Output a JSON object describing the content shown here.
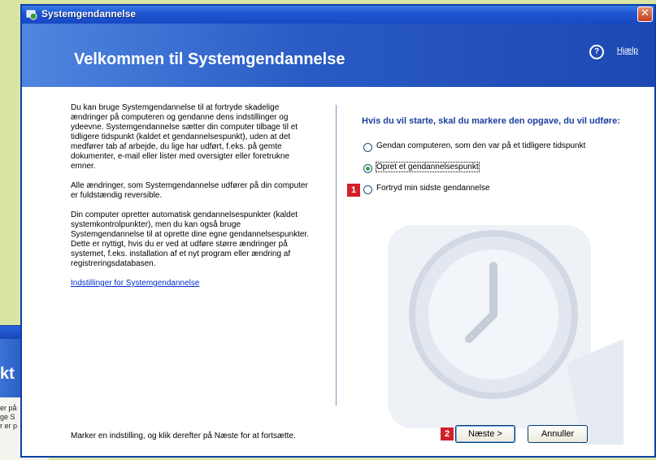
{
  "background_window": {
    "title_fragment": "kt",
    "body_lines": [
      "er på",
      "ge S",
      "r er p"
    ]
  },
  "window": {
    "title": "Systemgendannelse",
    "close_symbol": "✕"
  },
  "banner": {
    "title": "Velkommen til Systemgendannelse",
    "help_label": "Hjælp",
    "help_symbol": "?"
  },
  "left": {
    "paragraphs": [
      "Du kan bruge Systemgendannelse til at fortryde skadelige ændringer på computeren og gendanne dens indstillinger og ydeevne. Systemgendannelse sætter din computer tilbage til et tidligere tidspunkt (kaldet et gendannelsespunkt), uden at det medfører tab af arbejde, du lige har udført, f.eks. på gemte dokumenter, e-mail eller lister med oversigter eller foretrukne emner.",
      "Alle ændringer, som Systemgendannelse udfører på din computer er fuldstændig reversible.",
      "Din computer opretter automatisk gendannelsespunkter (kaldet systemkontrolpunkter), men du kan også bruge Systemgendannelse til at oprette dine egne gendannelsespunkter. Dette er nyttigt, hvis du er ved at udføre større ændringer på systemet, f.eks. installation af et nyt program eller ændring af registreringsdatabasen."
    ],
    "settings_link": "Indstillinger for Systemgendannelse"
  },
  "right": {
    "heading": "Hvis du vil starte, skal du markere den opgave, du vil udføre:",
    "options": [
      {
        "label": "Gendan computeren, som den var på et tidligere tidspunkt",
        "checked": false
      },
      {
        "label": "Opret et gendannelsespunkt",
        "checked": true
      },
      {
        "label": "Fortryd min sidste gendannelse",
        "checked": false
      }
    ]
  },
  "footer": {
    "instruction": "Marker en indstilling, og klik derefter på Næste for at fortsætte.",
    "next_label": "Næste >",
    "cancel_label": "Annuller"
  },
  "callouts": {
    "first": "1",
    "second": "2"
  },
  "colors": {
    "accent": "#1f56d4",
    "callout": "#d1202a",
    "heading": "#1c3f9e"
  }
}
